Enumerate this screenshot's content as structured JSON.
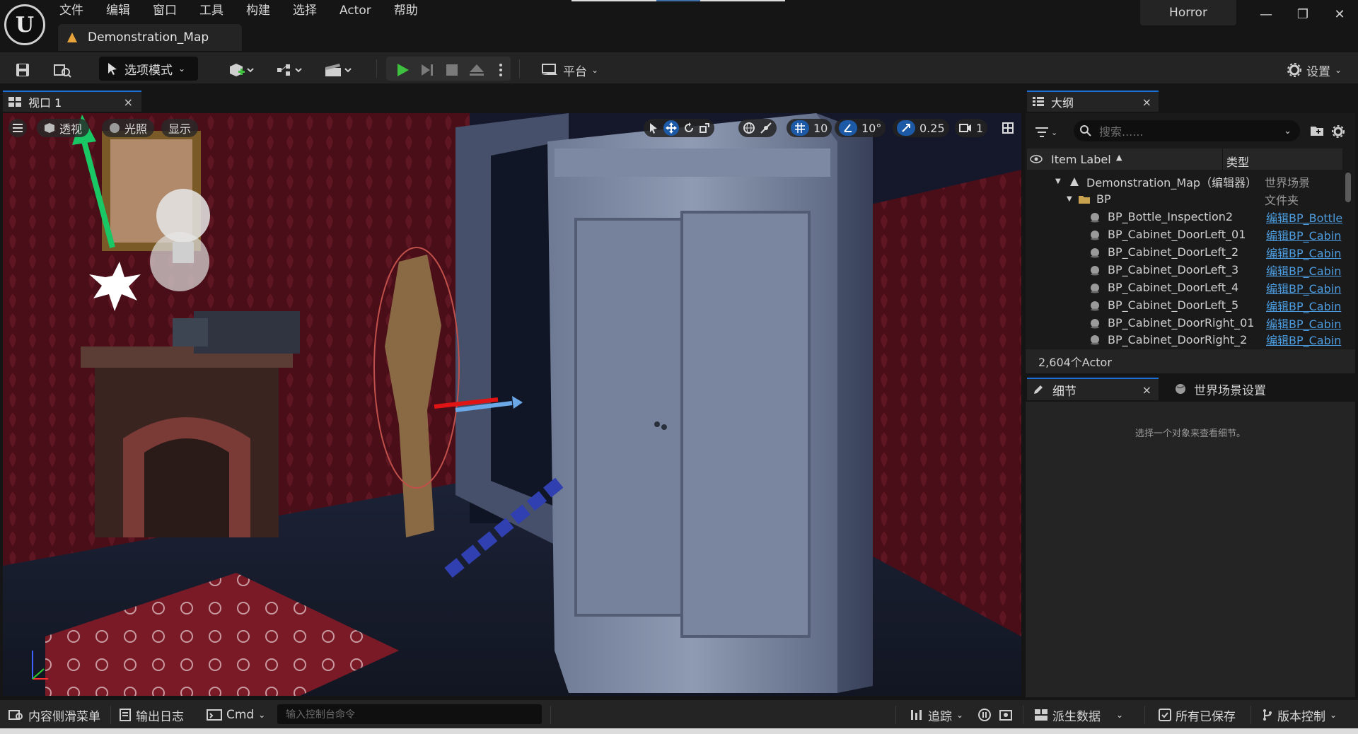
{
  "menu": [
    "文件",
    "编辑",
    "窗口",
    "工具",
    "构建",
    "选择",
    "Actor",
    "帮助"
  ],
  "document_tab": {
    "label": "Demonstration_Map"
  },
  "project": {
    "name": "Horror"
  },
  "window_controls": {
    "minimize": "—",
    "restore": "❐",
    "close": "✕"
  },
  "toolbar": {
    "mode_label": "选项模式",
    "platform_label": "平台",
    "settings_label": "设置"
  },
  "viewport": {
    "tab_label": "视口 1",
    "tab_close": "×",
    "perspective_label": "透视",
    "lighting_label": "光照",
    "show_label": "显示",
    "grid_snap": "10",
    "rotation_snap": "10°",
    "scale_snap": "0.25",
    "camera_speed": "1"
  },
  "outliner": {
    "tab_label": "大纲",
    "tab_close": "×",
    "search_placeholder": "搜索......",
    "col_label": "Item Label",
    "col_type": "类型",
    "rows": [
      {
        "label": "Demonstration_Map（编辑器）",
        "type": "世界场景",
        "kind": "map"
      },
      {
        "label": "BP",
        "type": "文件夹",
        "kind": "folder"
      },
      {
        "label": "BP_Bottle_Inspection2",
        "link": "编辑BP_Bottle",
        "kind": "actor"
      },
      {
        "label": "BP_Cabinet_DoorLeft_01",
        "link": "编辑BP_Cabin",
        "kind": "actor"
      },
      {
        "label": "BP_Cabinet_DoorLeft_2",
        "link": "编辑BP_Cabin",
        "kind": "actor"
      },
      {
        "label": "BP_Cabinet_DoorLeft_3",
        "link": "编辑BP_Cabin",
        "kind": "actor"
      },
      {
        "label": "BP_Cabinet_DoorLeft_4",
        "link": "编辑BP_Cabin",
        "kind": "actor"
      },
      {
        "label": "BP_Cabinet_DoorLeft_5",
        "link": "编辑BP_Cabin",
        "kind": "actor"
      },
      {
        "label": "BP_Cabinet_DoorRight_01",
        "link": "编辑BP_Cabin",
        "kind": "actor"
      },
      {
        "label": "BP_Cabinet_DoorRight_2",
        "link": "编辑BP_Cabin",
        "kind": "actor"
      }
    ],
    "count": "2,604个Actor"
  },
  "details": {
    "tab_label": "细节",
    "tab_close": "×",
    "world_settings_label": "世界场景设置",
    "empty_message": "选择一个对象来查看细节。"
  },
  "statusbar": {
    "content_drawer": "内容侧滑菜单",
    "output_log": "输出日志",
    "cmd": "Cmd",
    "console_placeholder": "输入控制台命令",
    "trace": "追踪",
    "derived_data": "派生数据",
    "all_saved": "所有已保存",
    "source_control": "版本控制"
  },
  "colors": {
    "accent": "#1c6fd4",
    "play_green": "#3ec13e",
    "link_blue": "#4d9de0"
  }
}
